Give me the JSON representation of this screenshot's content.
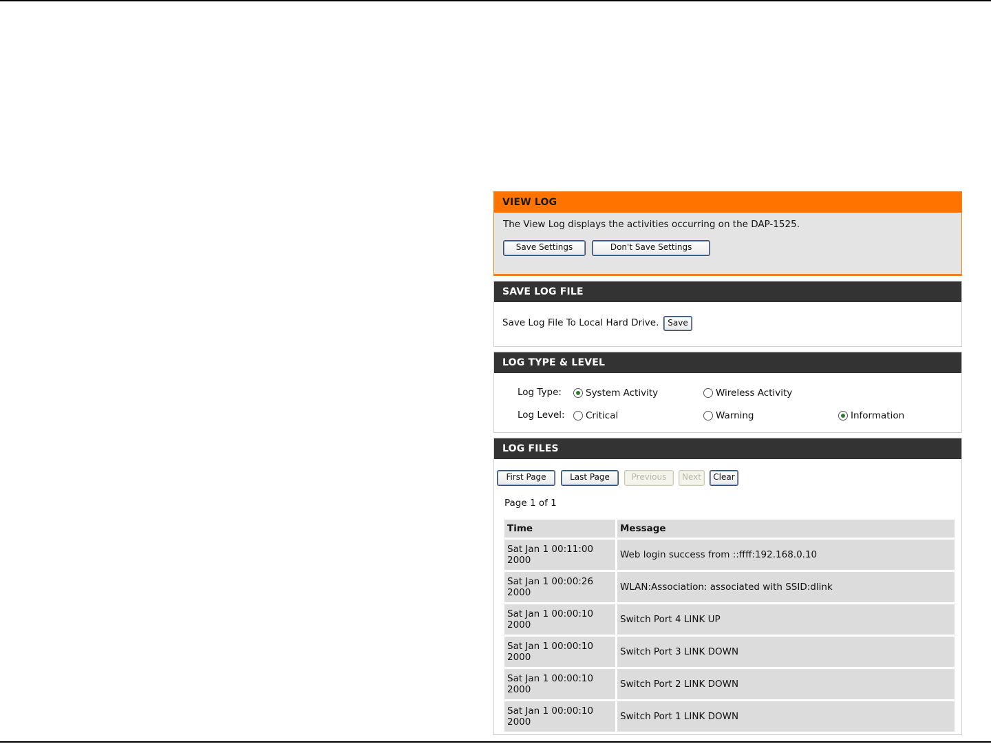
{
  "view_log": {
    "title": "VIEW LOG",
    "description": "The View Log displays the activities occurring on the DAP-1525.",
    "save_settings": "Save Settings",
    "dont_save_settings": "Don't Save Settings"
  },
  "save_log_file": {
    "title": "SAVE LOG FILE",
    "text": "Save Log File To Local Hard Drive.",
    "save": "Save"
  },
  "log_type_level": {
    "title": "LOG TYPE & LEVEL",
    "log_type_label": "Log Type:",
    "log_level_label": "Log Level:",
    "types": [
      {
        "label": "System Activity",
        "checked": true
      },
      {
        "label": "Wireless Activity",
        "checked": false
      }
    ],
    "levels": [
      {
        "label": "Critical",
        "checked": false
      },
      {
        "label": "Warning",
        "checked": false
      },
      {
        "label": "Information",
        "checked": true
      }
    ]
  },
  "log_files": {
    "title": "LOG FILES",
    "buttons": {
      "first_page": "First Page",
      "last_page": "Last Page",
      "previous": "Previous",
      "next": "Next",
      "clear": "Clear"
    },
    "page_info": "Page 1 of 1",
    "columns": [
      "Time",
      "Message"
    ],
    "rows": [
      {
        "time_1": "Sat Jan 1 00:11:00",
        "time_2": "2000",
        "message": "Web login success from ::ffff:192.168.0.10"
      },
      {
        "time_1": "Sat Jan 1 00:00:26",
        "time_2": "2000",
        "message": "WLAN:Association: associated with SSID:dlink"
      },
      {
        "time_1": "Sat Jan 1 00:00:10",
        "time_2": "2000",
        "message": "Switch Port 4 LINK UP"
      },
      {
        "time_1": "Sat Jan 1 00:00:10",
        "time_2": "2000",
        "message": "Switch Port 3 LINK DOWN"
      },
      {
        "time_1": "Sat Jan 1 00:00:10",
        "time_2": "2000",
        "message": "Switch Port 2 LINK DOWN"
      },
      {
        "time_1": "Sat Jan 1 00:00:10",
        "time_2": "2000",
        "message": "Switch Port 1 LINK DOWN"
      }
    ]
  },
  "colors": {
    "accent_orange": "#ff7400",
    "header_dark": "#333333",
    "cell_gray": "#dcdcdc"
  }
}
